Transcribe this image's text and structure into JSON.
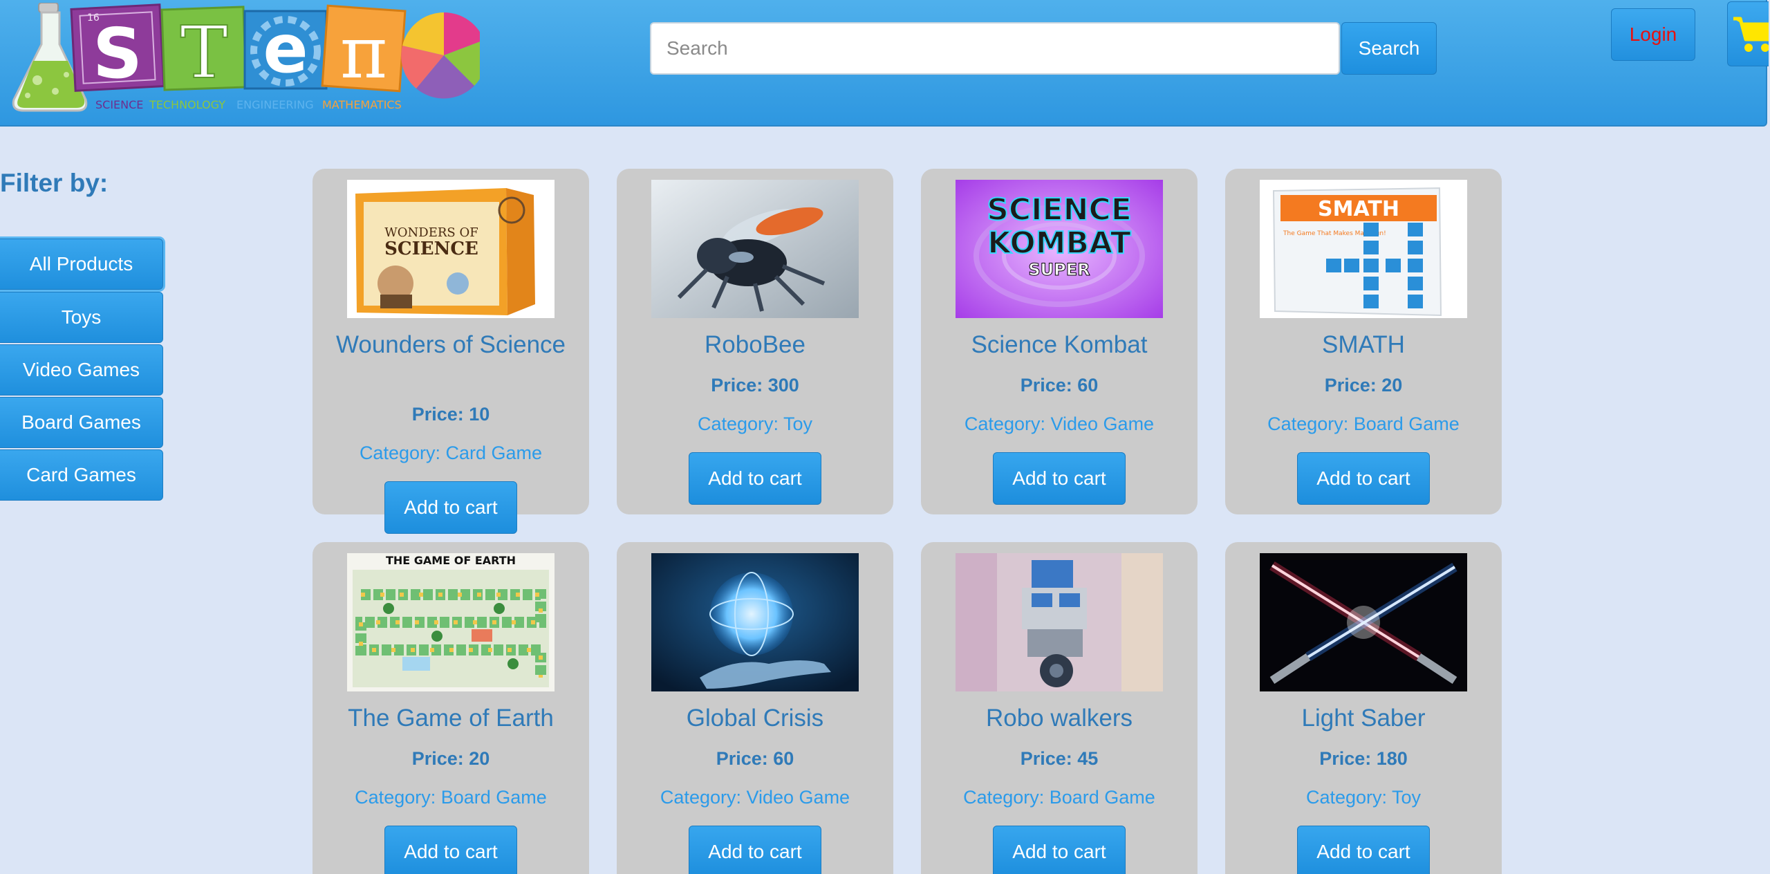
{
  "header": {
    "logo_letters": [
      "S",
      "T",
      "e",
      "π"
    ],
    "logo_words": [
      "SCIENCE",
      "TECHNOLOGY",
      "ENGINEERING",
      "MATHEMATICS"
    ],
    "logo_number": "16",
    "search_placeholder": "Search",
    "search_value": "",
    "search_label": "Search",
    "login_label": "Login",
    "cart_icon": "shopping-cart-icon"
  },
  "sidebar": {
    "title": "Filter by:",
    "filters": [
      {
        "label": "All Products",
        "active": true
      },
      {
        "label": "Toys"
      },
      {
        "label": "Video Games"
      },
      {
        "label": "Board Games"
      },
      {
        "label": "Card Games"
      }
    ]
  },
  "products": [
    {
      "title": "Wounders of Science",
      "price": "Price: 10",
      "category": "Category: Card Game",
      "button": "Add to cart",
      "image": "wonders-of-science-box"
    },
    {
      "title": "RoboBee",
      "price": "Price: 300",
      "category": "Category: Toy",
      "button": "Add to cart",
      "image": "robot-bee"
    },
    {
      "title": "Science Kombat",
      "price": "Price: 60",
      "category": "Category: Video Game",
      "button": "Add to cart",
      "image": "science-kombat-logo"
    },
    {
      "title": "SMATH",
      "price": "Price: 20",
      "category": "Category: Board Game",
      "button": "Add to cart",
      "image": "smath-box"
    },
    {
      "title": "The Game of Earth",
      "price": "Price: 20",
      "category": "Category: Board Game",
      "button": "Add to cart",
      "image": "game-of-earth-board"
    },
    {
      "title": "Global Crisis",
      "price": "Price: 60",
      "category": "Category: Video Game",
      "button": "Add to cart",
      "image": "glowing-globe-hand"
    },
    {
      "title": "Robo walkers",
      "price": "Price: 45",
      "category": "Category: Board Game",
      "button": "Add to cart",
      "image": "lego-robot"
    },
    {
      "title": "Light Saber",
      "price": "Price: 180",
      "category": "Category: Toy",
      "button": "Add to cart",
      "image": "crossed-light-sabers"
    }
  ],
  "image_texts": {
    "wonders_top": "WONDERS OF",
    "wonders_bottom": "SCIENCE",
    "kombat_line1": "SCIENCE",
    "kombat_line2": "KOMBAT",
    "kombat_line3": "SUPER",
    "smath": "SMATH",
    "smath_tagline": "The Game That Makes Math Fun!",
    "earth": "THE GAME OF EARTH"
  },
  "colors": {
    "header_blue": "#3aa3e8",
    "button_blue": "#2797e4",
    "card_gray": "#cbcbcb",
    "title_blue": "#2f7ab8",
    "category_blue": "#2b9bea",
    "login_red": "#e8110f",
    "cart_yellow": "#ffe600",
    "page_bg": "#dbe5f6"
  }
}
